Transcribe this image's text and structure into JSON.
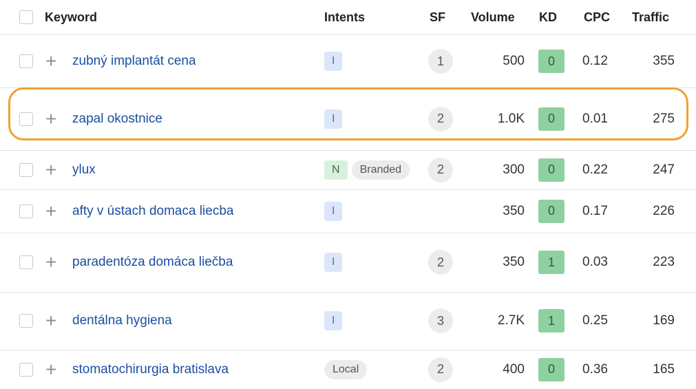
{
  "header": {
    "keyword": "Keyword",
    "intents": "Intents",
    "sf": "SF",
    "volume": "Volume",
    "kd": "KD",
    "cpc": "CPC",
    "traffic": "Traffic"
  },
  "rows": [
    {
      "keyword": "zubný implantát cena",
      "intents": [
        "I"
      ],
      "sf": "1",
      "volume": "500",
      "kd": "0",
      "cpc": "0.12",
      "traffic": "355"
    },
    {
      "keyword": "zapal okostnice",
      "intents": [
        "I"
      ],
      "sf": "2",
      "volume": "1.0K",
      "kd": "0",
      "cpc": "0.01",
      "traffic": "275"
    },
    {
      "keyword": "ylux",
      "intents": [
        "N",
        "Branded"
      ],
      "sf": "2",
      "volume": "300",
      "kd": "0",
      "cpc": "0.22",
      "traffic": "247"
    },
    {
      "keyword": "afty v ústach domaca liecba",
      "intents": [
        "I"
      ],
      "sf": "",
      "volume": "350",
      "kd": "0",
      "cpc": "0.17",
      "traffic": "226"
    },
    {
      "keyword": "paradentóza domáca liečba",
      "intents": [
        "I"
      ],
      "sf": "2",
      "volume": "350",
      "kd": "1",
      "cpc": "0.03",
      "traffic": "223"
    },
    {
      "keyword": "dentálna hygiena",
      "intents": [
        "I"
      ],
      "sf": "3",
      "volume": "2.7K",
      "kd": "1",
      "cpc": "0.25",
      "traffic": "169"
    },
    {
      "keyword": "stomatochirurgia bratislava",
      "intents": [
        "Local"
      ],
      "sf": "2",
      "volume": "400",
      "kd": "0",
      "cpc": "0.36",
      "traffic": "165"
    }
  ],
  "colors": {
    "keyword_link": "#1a4fa0",
    "kd_0": "#8fd0a0",
    "kd_1": "#8fd0a0",
    "highlight_border": "#f0a030"
  },
  "icons": {
    "add": "plus-icon"
  }
}
